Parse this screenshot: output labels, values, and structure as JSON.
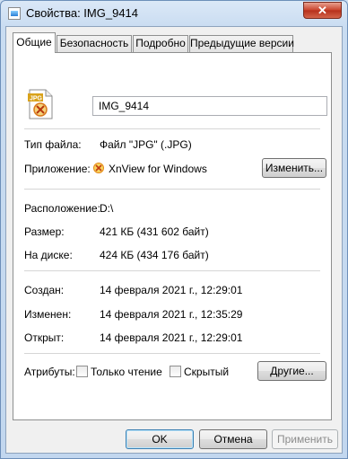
{
  "window": {
    "title": "Свойства: IMG_9414",
    "close_label": "✕"
  },
  "tabs": [
    {
      "label": "Общие",
      "active": true
    },
    {
      "label": "Безопасность",
      "active": false
    },
    {
      "label": "Подробно",
      "active": false
    },
    {
      "label": "Предыдущие версии",
      "active": false
    }
  ],
  "general": {
    "file_icon_label": "JPG",
    "filename": "IMG_9414",
    "file_type_label": "Тип файла:",
    "file_type_value": "Файл \"JPG\" (.JPG)",
    "app_label": "Приложение:",
    "app_value": "XnView for Windows",
    "change_button": "Изменить...",
    "location_label": "Расположение:",
    "location_value": "D:\\",
    "size_label": "Размер:",
    "size_value": "421 КБ (431 602 байт)",
    "disk_label": "На диске:",
    "disk_value": "424 КБ (434 176 байт)",
    "created_label": "Создан:",
    "created_value": "14 февраля 2021 г., 12:29:01",
    "modified_label": "Изменен:",
    "modified_value": "14 февраля 2021 г., 12:35:29",
    "opened_label": "Открыт:",
    "opened_value": "14 февраля 2021 г., 12:29:01",
    "attributes_label": "Атрибуты:",
    "readonly_label": "Только чтение",
    "hidden_label": "Скрытый",
    "other_button": "Другие..."
  },
  "footer": {
    "ok": "OK",
    "cancel": "Отмена",
    "apply": "Применить"
  }
}
